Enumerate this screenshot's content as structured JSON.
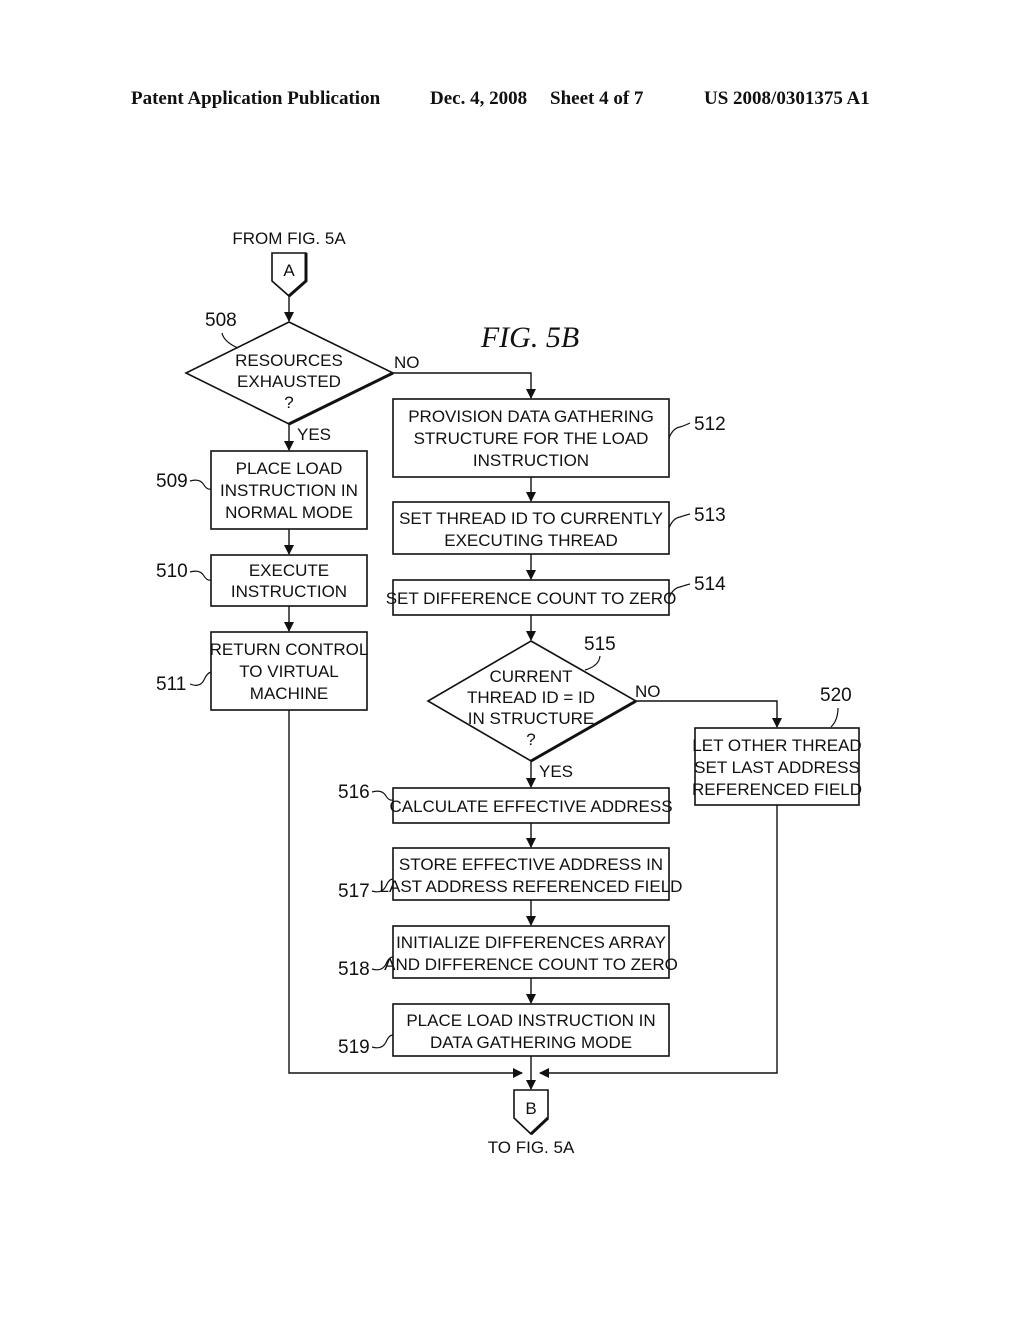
{
  "header": {
    "publication": "Patent Application Publication",
    "date": "Dec. 4, 2008",
    "sheet": "Sheet 4 of 7",
    "number": "US 2008/0301375 A1"
  },
  "figure": {
    "title": "FIG. 5B",
    "connector_in": {
      "letter": "A",
      "label": "FROM FIG. 5A"
    },
    "connector_out": {
      "letter": "B",
      "label": "TO FIG. 5A"
    },
    "decisions": {
      "d508": {
        "ref": "508",
        "lines": [
          "RESOURCES",
          "EXHAUSTED",
          "?"
        ],
        "yes": "YES",
        "no": "NO"
      },
      "d515": {
        "ref": "515",
        "lines": [
          "CURRENT",
          "THREAD ID = ID",
          "IN STRUCTURE",
          "?"
        ],
        "yes": "YES",
        "no": "NO"
      }
    },
    "steps": {
      "s509": {
        "ref": "509",
        "lines": [
          "PLACE LOAD",
          "INSTRUCTION IN",
          "NORMAL MODE"
        ]
      },
      "s510": {
        "ref": "510",
        "lines": [
          "EXECUTE",
          "INSTRUCTION"
        ]
      },
      "s511": {
        "ref": "511",
        "lines": [
          "RETURN CONTROL",
          "TO VIRTUAL",
          "MACHINE"
        ]
      },
      "s512": {
        "ref": "512",
        "lines": [
          "PROVISION DATA GATHERING",
          "STRUCTURE FOR THE LOAD",
          "INSTRUCTION"
        ]
      },
      "s513": {
        "ref": "513",
        "lines": [
          "SET THREAD ID TO CURRENTLY",
          "EXECUTING THREAD"
        ]
      },
      "s514": {
        "ref": "514",
        "lines": [
          "SET DIFFERENCE COUNT TO ZERO"
        ]
      },
      "s516": {
        "ref": "516",
        "lines": [
          "CALCULATE EFFECTIVE ADDRESS"
        ]
      },
      "s517": {
        "ref": "517",
        "lines": [
          "STORE EFFECTIVE ADDRESS IN",
          "LAST ADDRESS REFERENCED FIELD"
        ]
      },
      "s518": {
        "ref": "518",
        "lines": [
          "INITIALIZE DIFFERENCES ARRAY",
          "AND DIFFERENCE COUNT TO ZERO"
        ]
      },
      "s519": {
        "ref": "519",
        "lines": [
          "PLACE LOAD INSTRUCTION IN",
          "DATA GATHERING MODE"
        ]
      },
      "s520": {
        "ref": "520",
        "lines": [
          "LET OTHER THREAD",
          "SET LAST ADDRESS",
          "REFERENCED FIELD"
        ]
      }
    }
  }
}
